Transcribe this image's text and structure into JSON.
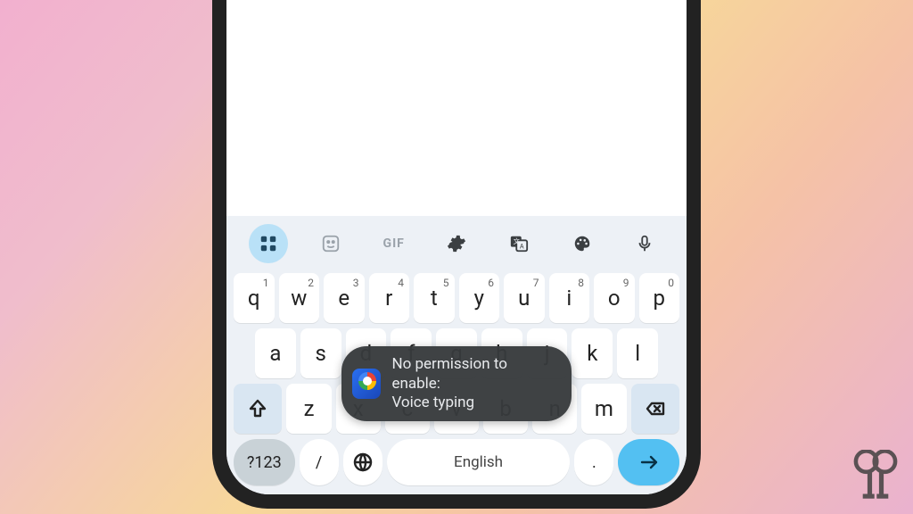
{
  "toolbar": {
    "items": [
      {
        "name": "apps-icon",
        "type": "grid",
        "active": true,
        "interactable": true
      },
      {
        "name": "sticker-icon",
        "type": "sticker",
        "faded": true,
        "interactable": true
      },
      {
        "name": "gif-icon",
        "type": "gif",
        "label": "GIF",
        "faded": true,
        "interactable": true
      },
      {
        "name": "settings-icon",
        "type": "gear",
        "interactable": true
      },
      {
        "name": "translate-icon",
        "type": "translate",
        "interactable": true
      },
      {
        "name": "theme-icon",
        "type": "palette",
        "interactable": true
      },
      {
        "name": "voice-icon",
        "type": "mic",
        "interactable": true
      }
    ]
  },
  "rows": {
    "r1": [
      {
        "l": "q",
        "n": "1"
      },
      {
        "l": "w",
        "n": "2"
      },
      {
        "l": "e",
        "n": "3"
      },
      {
        "l": "r",
        "n": "4"
      },
      {
        "l": "t",
        "n": "5"
      },
      {
        "l": "y",
        "n": "6"
      },
      {
        "l": "u",
        "n": "7"
      },
      {
        "l": "i",
        "n": "8"
      },
      {
        "l": "o",
        "n": "9"
      },
      {
        "l": "p",
        "n": "0"
      }
    ],
    "r2": [
      {
        "l": "a"
      },
      {
        "l": "s"
      },
      {
        "l": "d"
      },
      {
        "l": "f"
      },
      {
        "l": "g"
      },
      {
        "l": "h"
      },
      {
        "l": "j"
      },
      {
        "l": "k"
      },
      {
        "l": "l"
      }
    ],
    "r3": [
      {
        "l": "z"
      },
      {
        "l": "x"
      },
      {
        "l": "c"
      },
      {
        "l": "v"
      },
      {
        "l": "b"
      },
      {
        "l": "n"
      },
      {
        "l": "m"
      }
    ]
  },
  "bottom": {
    "symbols_label": "?123",
    "slash": "/",
    "space_label": "English",
    "period": "."
  },
  "toast": {
    "line1": "No permission to enable:",
    "line2": "Voice typing"
  }
}
